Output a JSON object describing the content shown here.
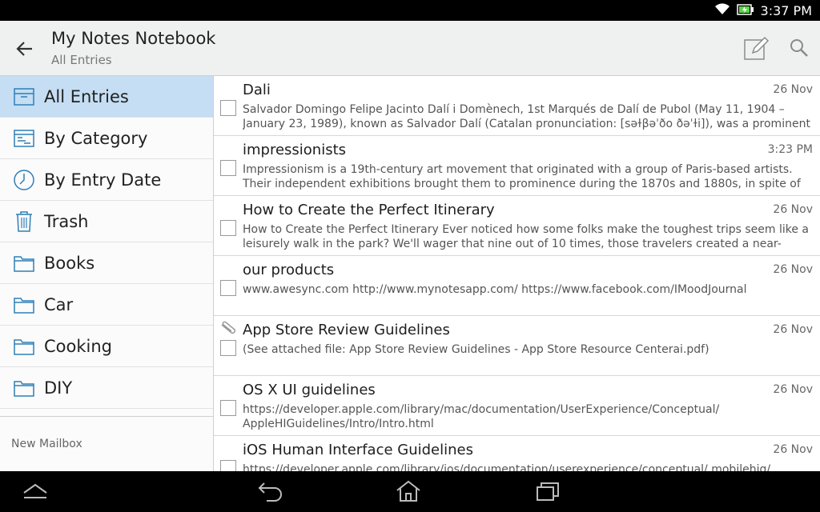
{
  "status": {
    "time": "3:37 PM",
    "icons": [
      "wifi-icon",
      "battery-charging-icon"
    ]
  },
  "header": {
    "title": "My Notes Notebook",
    "subtitle": "All Entries",
    "actions": [
      "new-entry-icon",
      "search-icon"
    ]
  },
  "sidebar": {
    "items": [
      {
        "label": "All Entries",
        "icon": "inbox-icon",
        "selected": true
      },
      {
        "label": "By Category",
        "icon": "category-icon"
      },
      {
        "label": "By Entry Date",
        "icon": "clock-icon"
      },
      {
        "label": "Trash",
        "icon": "trash-icon"
      },
      {
        "label": "Books",
        "icon": "folder-icon"
      },
      {
        "label": "Car",
        "icon": "folder-icon"
      },
      {
        "label": "Cooking",
        "icon": "folder-icon"
      },
      {
        "label": "DIY",
        "icon": "folder-icon"
      }
    ],
    "footer": "New Mailbox"
  },
  "entries": [
    {
      "title": "Dali",
      "date": "26 Nov",
      "attachment": false,
      "body": "Salvador Domingo Felipe Jacinto Dalí i Domènech, 1st Marqués de Dalí de Pubol (May 11, 1904 – January 23, 1989), known as Salvador Dalí (Catalan pronunciation: [səɫβəˈðo ðəˈɫi]), was a prominent"
    },
    {
      "title": "impressionists",
      "date": "3:23 PM",
      "attachment": false,
      "body": "Impressionism is a 19th-century art movement that originated with a group of Paris-based artists. Their independent exhibitions brought them to prominence during the 1870s and 1880s, in spite of"
    },
    {
      "title": "How to Create the Perfect Itinerary",
      "date": "26 Nov",
      "attachment": false,
      "body": "How to Create the Perfect Itinerary Ever noticed how some folks make the toughest trips seem like a leisurely walk in the park? We'll wager that nine out of 10 times, those travelers created a near-perfect"
    },
    {
      "title": "our products",
      "date": "26 Nov",
      "attachment": false,
      "body": "www.awesync.com http://www.mynotesapp.com/ https://www.facebook.com/IMoodJournal"
    },
    {
      "title": "App Store Review Guidelines",
      "date": "26 Nov",
      "attachment": true,
      "body": "(See attached file: App Store Review Guidelines - App Store Resource Centerai.pdf)"
    },
    {
      "title": "OS X UI guidelines",
      "date": "26 Nov",
      "attachment": false,
      "body": "https://developer.apple.com/library/mac/documentation/UserExperience/Conceptual/ AppleHIGuidelines/Intro/Intro.html"
    },
    {
      "title": "iOS Human Interface Guidelines",
      "date": "26 Nov",
      "attachment": false,
      "body": "https://developer.apple.com/library/ios/documentation/userexperience/conceptual/ mobilehig/"
    }
  ],
  "navbar": {
    "icons": [
      "home-up-icon",
      "back-icon",
      "home-icon",
      "recent-apps-icon"
    ]
  },
  "colors": {
    "selected": "#c5def3",
    "header": "#eff0f0",
    "accent": "#2e6ea0"
  }
}
